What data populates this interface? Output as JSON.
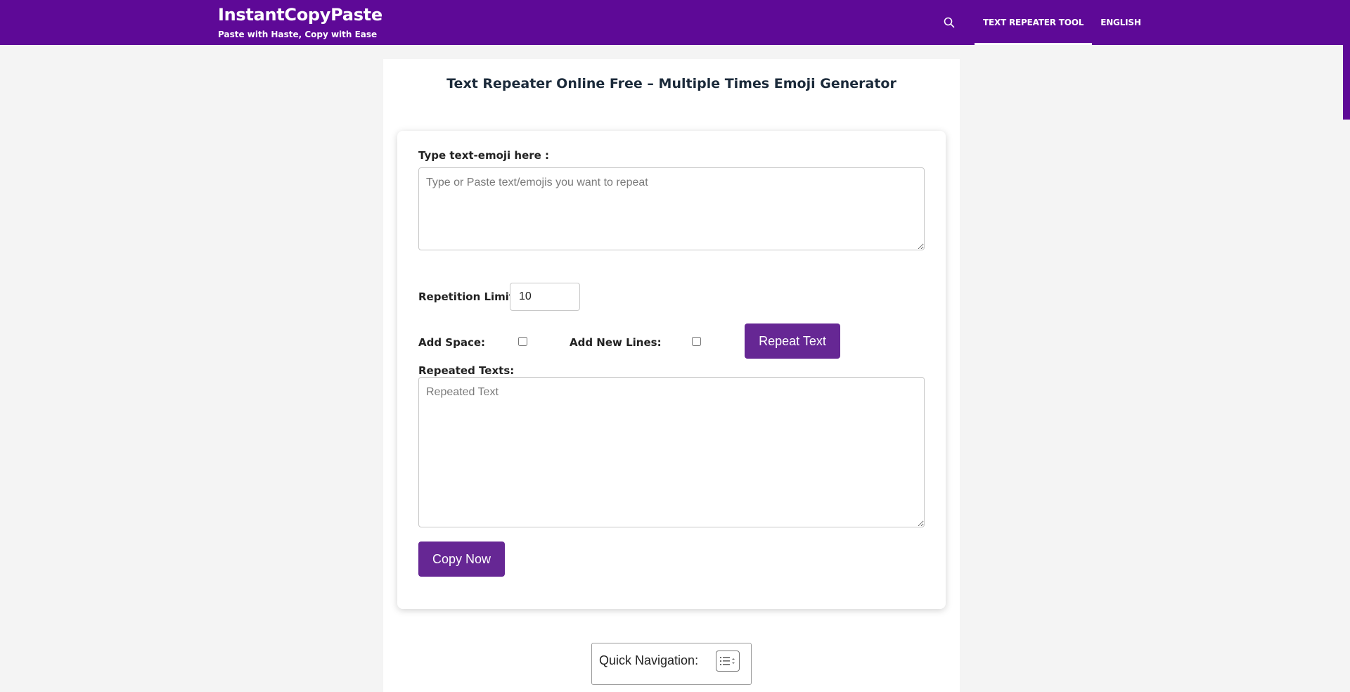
{
  "header": {
    "site_title": "InstantCopyPaste",
    "tagline": "Paste with Haste, Copy with Ease",
    "search_icon": "search-icon",
    "nav": [
      {
        "label": "Text Repeater Tool",
        "active": true
      },
      {
        "label": "English",
        "active": false
      }
    ]
  },
  "colors": {
    "header_bg": "#5e0997",
    "button_bg": "#662794",
    "page_bg": "#f4f4f4"
  },
  "page": {
    "title": "Text Repeater Online Free – Multiple Times Emoji Generator"
  },
  "tool": {
    "input_label": "Type text-emoji here :",
    "input_placeholder": "Type or Paste text/emojis you want to repeat",
    "repetition_label": "Repetition Limit:",
    "repetition_value": "10",
    "add_space_label": "Add Space:",
    "add_space_checked": false,
    "add_newlines_label": "Add New Lines:",
    "add_newlines_checked": false,
    "repeat_button": "Repeat Text",
    "output_label": "Repeated Texts:",
    "output_placeholder": "Repeated Text",
    "copy_button": "Copy Now"
  },
  "quick_nav": {
    "label": "Quick Navigation:",
    "toggle_icon": "list-toggle-icon"
  }
}
